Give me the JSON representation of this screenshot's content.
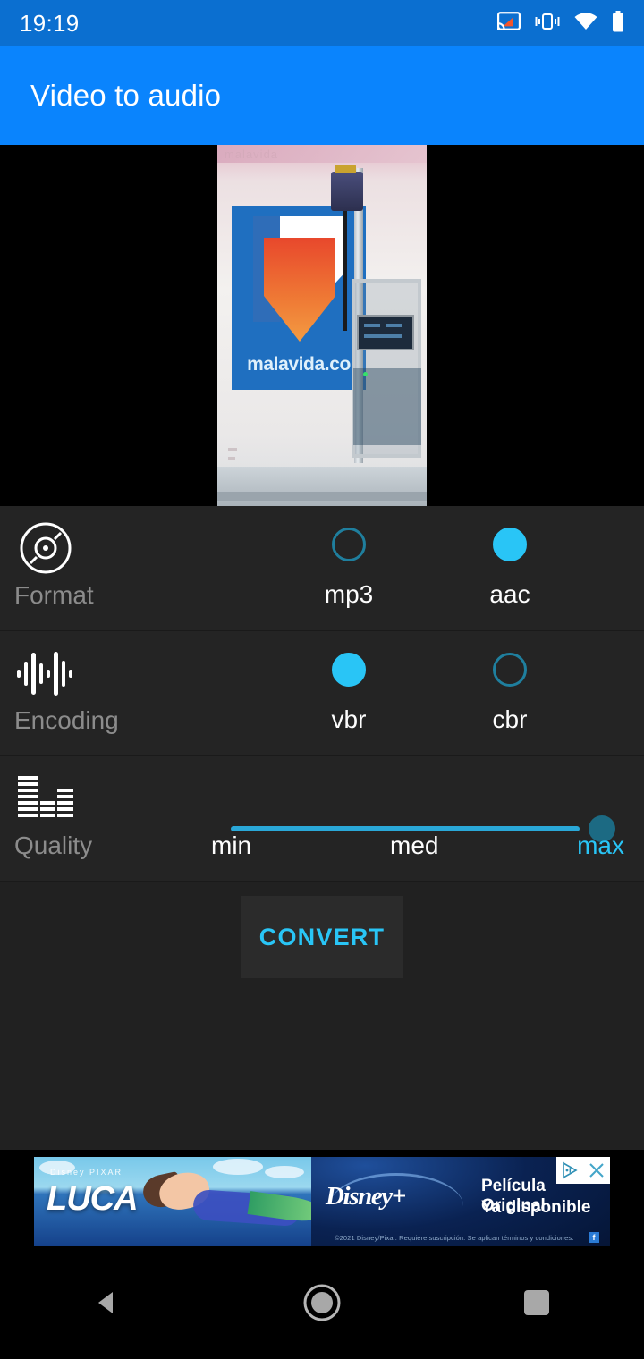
{
  "status_bar": {
    "clock": "19:19",
    "icons": [
      "cast-icon",
      "vibrate-icon",
      "wifi-icon",
      "battery-icon"
    ],
    "background": "#0b6fd0"
  },
  "toolbar": {
    "title": "Video to audio",
    "background": "#0a84fd"
  },
  "preview": {
    "name": "video-preview",
    "watermark": "malavida",
    "poster_text": "malavida.co"
  },
  "options": [
    {
      "id": "format",
      "label": "Format",
      "icon": "disc-icon",
      "choices": [
        {
          "value": "mp3",
          "selected": false
        },
        {
          "value": "aac",
          "selected": true
        }
      ]
    },
    {
      "id": "encoding",
      "label": "Encoding",
      "icon": "waveform-icon",
      "choices": [
        {
          "value": "vbr",
          "selected": true
        },
        {
          "value": "cbr",
          "selected": false
        }
      ]
    }
  ],
  "quality": {
    "label": "Quality",
    "icon": "equalizer-icon",
    "ticks": [
      "min",
      "med",
      "max"
    ],
    "selected_tick": "max",
    "slider_percent": 100,
    "track_color": "#2aa8d8",
    "thumb_color": "#1c6a83"
  },
  "convert": {
    "label": "CONVERT",
    "text_color": "#29c5f6"
  },
  "ad": {
    "title": "LUCA",
    "studio": "Disney PIXAR",
    "brand": "Disney+",
    "line1": "Película Original",
    "line2": "Ya disponible",
    "legal": "©2021 Disney/Pixar. Requiere suscripción. Se aplican términos y condiciones.",
    "social": "f",
    "adchoices_icon": "adchoices-icon",
    "close_icon": "close-icon"
  },
  "nav_bar": {
    "buttons": [
      {
        "name": "back-button",
        "icon": "triangle-left-icon"
      },
      {
        "name": "home-button",
        "icon": "circle-icon"
      },
      {
        "name": "recents-button",
        "icon": "square-icon"
      }
    ]
  },
  "theme": {
    "accent": "#29c5f6",
    "row_background": "#242424",
    "page_background": "#212121",
    "label_color": "#8c8c8c"
  }
}
